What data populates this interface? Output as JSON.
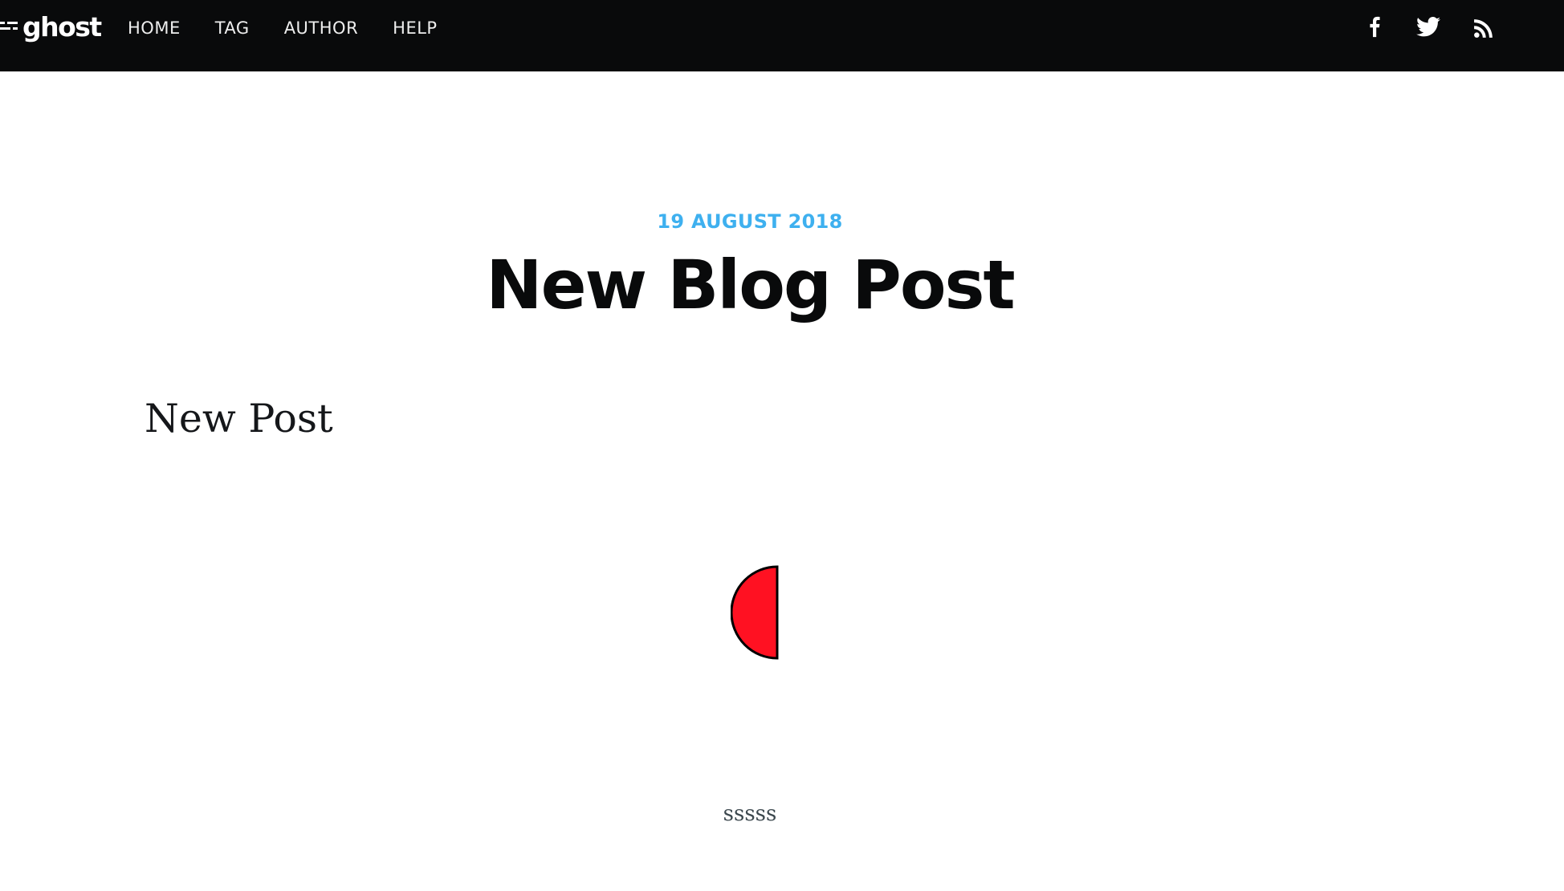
{
  "header": {
    "brand": "ghost",
    "brand_icon": "ghost-logo-icon",
    "nav": [
      {
        "label": "HOME"
      },
      {
        "label": "TAG"
      },
      {
        "label": "AUTHOR"
      },
      {
        "label": "HELP"
      }
    ],
    "social": [
      {
        "icon": "facebook-icon"
      },
      {
        "icon": "twitter-icon"
      },
      {
        "icon": "rss-icon"
      }
    ]
  },
  "post": {
    "date": "19 AUGUST 2018",
    "title": "New Blog Post",
    "content_heading": "New Post",
    "body_text": "sssss"
  },
  "colors": {
    "header_background": "#090a0b",
    "date_accent": "#3eb0ef",
    "figure_fill": "#ff1122"
  }
}
